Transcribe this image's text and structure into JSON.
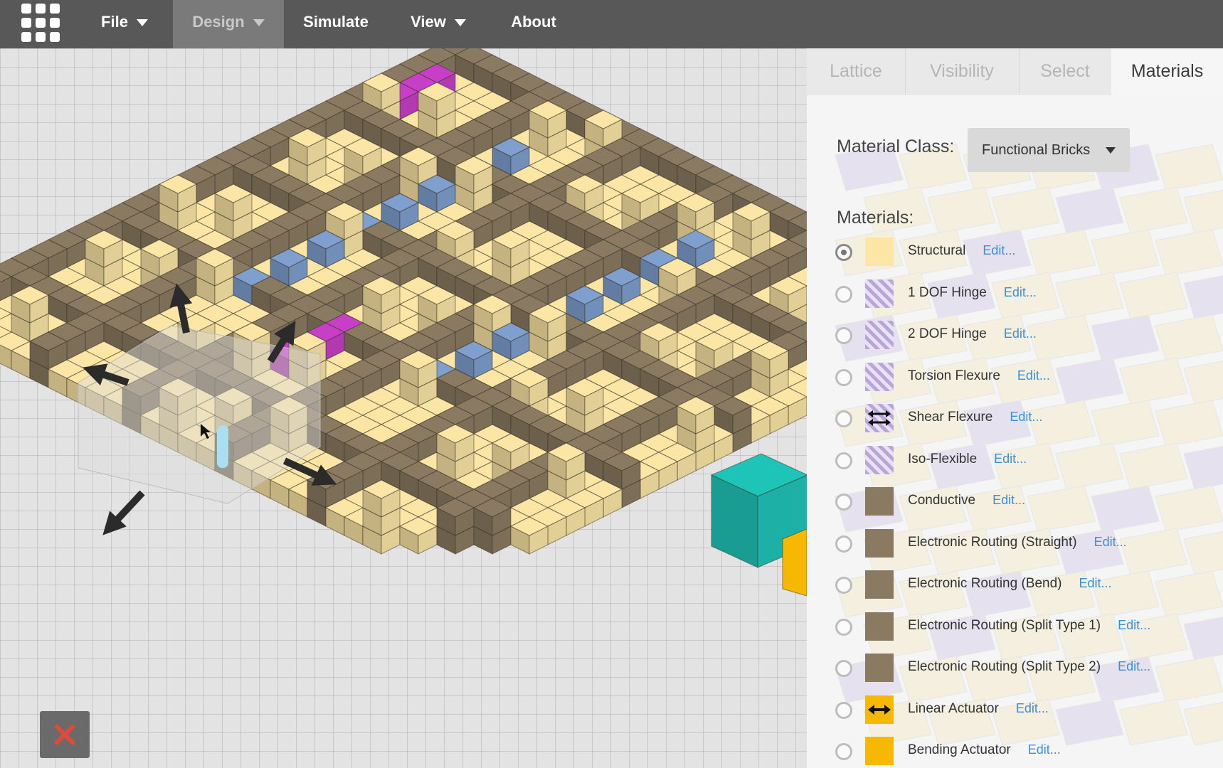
{
  "menu": {
    "items": [
      {
        "label": "File",
        "has_dropdown": true
      },
      {
        "label": "Design",
        "has_dropdown": true,
        "active": true
      },
      {
        "label": "Simulate",
        "has_dropdown": false
      },
      {
        "label": "View",
        "has_dropdown": true
      },
      {
        "label": "About",
        "has_dropdown": false
      }
    ]
  },
  "panel": {
    "tabs": [
      {
        "label": "Lattice"
      },
      {
        "label": "Visibility"
      },
      {
        "label": "Select"
      },
      {
        "label": "Materials",
        "active": true
      }
    ],
    "material_class_label": "Material Class:",
    "material_class_value": "Functional Bricks",
    "materials_label": "Materials:",
    "edit_label": "Edit...",
    "materials": [
      {
        "name": "Structural",
        "swatch": "#fbe6a6",
        "selected": true
      },
      {
        "name": "1 DOF Hinge",
        "swatch": "hatch"
      },
      {
        "name": "2 DOF Hinge",
        "swatch": "hatch"
      },
      {
        "name": "Torsion Flexure",
        "swatch": "hatch"
      },
      {
        "name": "Shear Flexure",
        "swatch": "hatch",
        "icon": "double-arrow-vertical-icon"
      },
      {
        "name": "Iso-Flexible",
        "swatch": "hatch"
      },
      {
        "name": "Conductive",
        "swatch": "#8b7a62"
      },
      {
        "name": "Electronic Routing (Straight)",
        "swatch": "#8b7a62"
      },
      {
        "name": "Electronic Routing (Bend)",
        "swatch": "#8b7a62"
      },
      {
        "name": "Electronic Routing (Split Type 1)",
        "swatch": "#8b7a62"
      },
      {
        "name": "Electronic Routing (Split Type 2)",
        "swatch": "#8b7a62"
      },
      {
        "name": "Linear Actuator",
        "swatch": "#f6b800",
        "icon": "horizontal-double-arrow-icon"
      },
      {
        "name": "Bending Actuator",
        "swatch": "#f6b800"
      }
    ]
  },
  "colors": {
    "structural": "#fbe6a6",
    "routing": "#8b7a62",
    "hinge_blue": "#7f9fcf",
    "magenta": "#c73fc6",
    "teal": "#1fc4b8",
    "actuator": "#f6b800",
    "link": "#3b8fd6"
  },
  "viewport": {
    "icons": [
      "move-up-arrow-icon",
      "move-down-arrow-icon",
      "move-left-arrow-icon",
      "move-right-arrow-icon",
      "cursor-icon"
    ],
    "delete_icon": "close-x-icon"
  }
}
